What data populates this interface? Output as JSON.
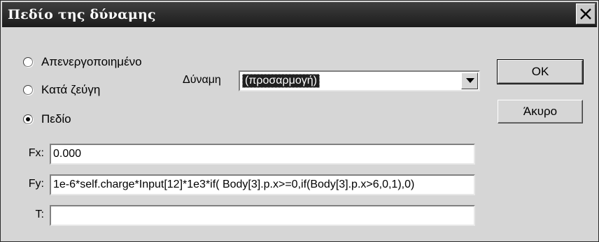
{
  "dialog": {
    "title": "Πεδίο της δύναμης",
    "close_glyph": "×"
  },
  "mode": {
    "options": [
      {
        "label": "Απενεργοποιημένο",
        "selected": false
      },
      {
        "label": "Κατά ζεύγη",
        "selected": false
      },
      {
        "label": "Πεδίο",
        "selected": true
      }
    ]
  },
  "force": {
    "label": "Δύναμη",
    "selected_value": "(προσαρμογή)"
  },
  "buttons": {
    "ok_label": "OK",
    "cancel_label": "Άκυρο"
  },
  "fields": {
    "fx": {
      "label": "Fx:",
      "value": "0.000"
    },
    "fy": {
      "label": "Fy:",
      "value": "1e-6*self.charge*Input[12]*1e3*if( Body[3].p.x>=0,if(Body[3].p.x>6,0,1),0)"
    },
    "t": {
      "label": "T:",
      "value": ""
    }
  },
  "icons": {
    "close": "close-icon",
    "dropdown": "chevron-down-icon",
    "radio_selected": "radio-dot-icon"
  }
}
